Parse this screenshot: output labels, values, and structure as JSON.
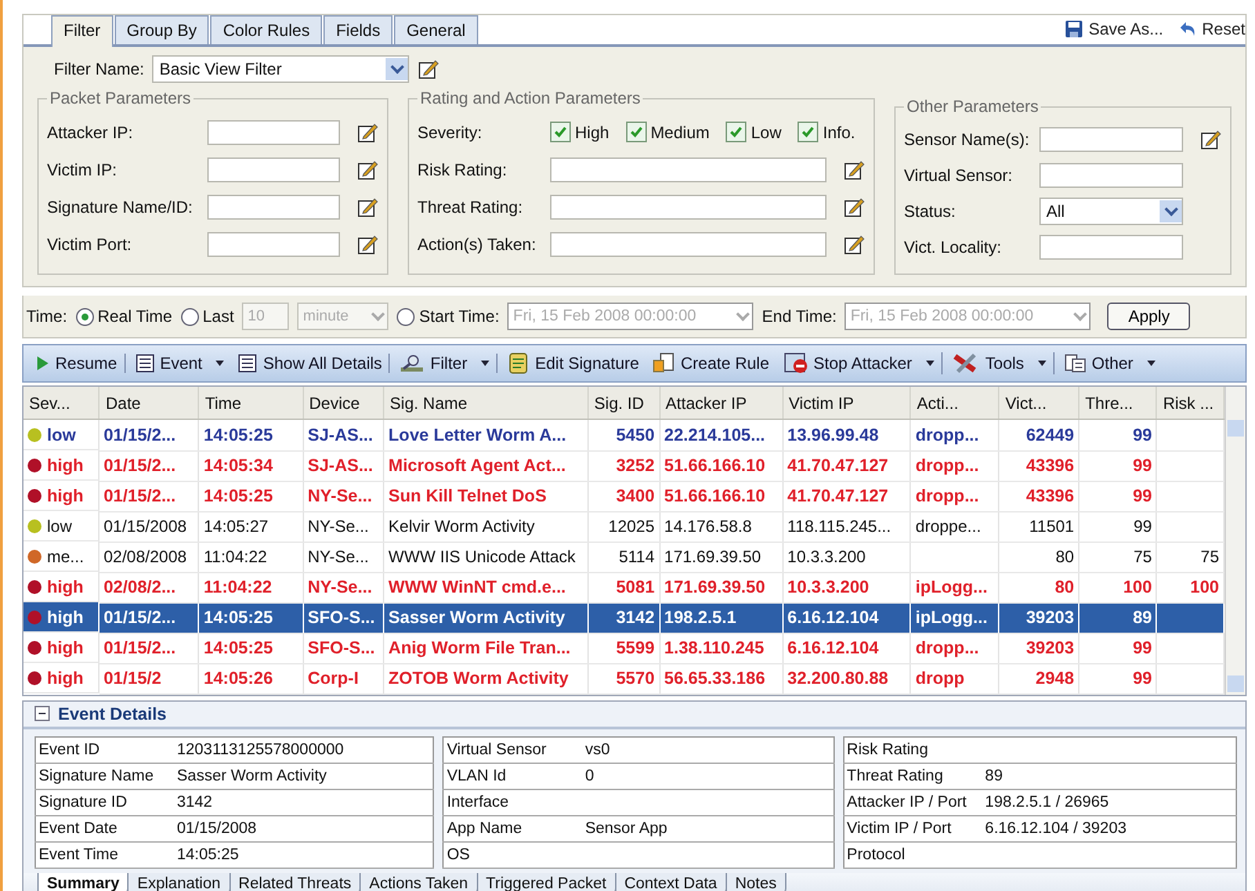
{
  "filter_tabs": [
    {
      "label": "Filter",
      "selected": true
    },
    {
      "label": "Group By",
      "selected": false
    },
    {
      "label": "Color Rules",
      "selected": false
    },
    {
      "label": "Fields",
      "selected": false
    },
    {
      "label": "General",
      "selected": false
    }
  ],
  "actions": [
    "Save As...",
    "Reset"
  ],
  "filter_name": {
    "label": "Filter Name:",
    "value": "Basic View Filter"
  },
  "packet_parameters": {
    "title": "Packet Parameters",
    "fields": [
      "Attacker IP:",
      "Victim IP:",
      "Signature Name/ID:",
      "Victim Port:"
    ]
  },
  "rating_parameters": {
    "title": "Rating and Action Parameters",
    "severity_label": "Severity:",
    "severity": [
      {
        "label": "High",
        "checked": true
      },
      {
        "label": "Medium",
        "checked": true
      },
      {
        "label": "Low",
        "checked": true
      },
      {
        "label": "Info.",
        "checked": true
      }
    ],
    "fields": [
      "Risk Rating:",
      "Threat Rating:",
      "Action(s) Taken:"
    ]
  },
  "other_parameters": {
    "title": "Other Parameters",
    "fields": [
      {
        "label": "Sensor Name(s):",
        "kind": "edit"
      },
      {
        "label": "Virtual Sensor:",
        "kind": "text"
      },
      {
        "label": "Status:",
        "kind": "select",
        "value": "All"
      },
      {
        "label": "Vict. Locality:",
        "kind": "text"
      }
    ]
  },
  "time": {
    "label": "Time:",
    "real_time": {
      "label": "Real Time",
      "selected": true
    },
    "last": {
      "label": "Last",
      "selected": false,
      "count": "10",
      "unit": "minute"
    },
    "start": {
      "label": "Start Time:",
      "selected": false,
      "value": "Fri, 15 Feb 2008 00:00:00"
    },
    "end": {
      "label": "End Time:",
      "value": "Fri, 15 Feb 2008 00:00:00"
    },
    "apply": "Apply"
  },
  "toolbar": [
    {
      "label": "Resume",
      "kind": "play",
      "dropdown": false,
      "separator": true
    },
    {
      "label": "Event",
      "kind": "list",
      "dropdown": true,
      "separator": false
    },
    {
      "label": "Show All Details",
      "kind": "list",
      "dropdown": false,
      "separator": true
    },
    {
      "label": "Filter",
      "kind": "filter",
      "dropdown": true,
      "separator": true
    },
    {
      "label": "Edit Signature",
      "kind": "scroll",
      "dropdown": false,
      "separator": false
    },
    {
      "label": "Create Rule",
      "kind": "rule",
      "dropdown": false,
      "separator": false
    },
    {
      "label": "Stop Attacker",
      "kind": "stop",
      "dropdown": true,
      "separator": true
    },
    {
      "label": "Tools",
      "kind": "tools",
      "dropdown": true,
      "separator": true
    },
    {
      "label": "Other",
      "kind": "doc",
      "dropdown": true,
      "separator": false
    }
  ],
  "table": {
    "columns": [
      "Sev...",
      "Date",
      "Time",
      "Device",
      "Sig. Name",
      "Sig. ID",
      "Attacker IP",
      "Victim IP",
      "Acti...",
      "Vict...",
      "Thre...",
      "Risk ..."
    ],
    "rows": [
      {
        "kind": "low",
        "new": true,
        "selected": false,
        "cells": [
          "low",
          "01/15/2...",
          "14:05:25",
          "SJ-AS...",
          "Love Letter Worm A...",
          "5450",
          "22.214.105...",
          "13.96.99.48",
          "dropp...",
          "62449",
          "99",
          null
        ]
      },
      {
        "kind": "high",
        "new": true,
        "selected": false,
        "cells": [
          "high",
          "01/15/2...",
          "14:05:34",
          "SJ-AS...",
          "Microsoft Agent Act...",
          "3252",
          "51.66.166.10",
          "41.70.47.127",
          "dropp...",
          "43396",
          "99",
          null
        ]
      },
      {
        "kind": "high",
        "new": true,
        "selected": false,
        "cells": [
          "high",
          "01/15/2...",
          "14:05:25",
          "NY-Se...",
          "Sun Kill Telnet DoS",
          "3400",
          "51.66.166.10",
          "41.70.47.127",
          "dropp...",
          "43396",
          "99",
          null
        ]
      },
      {
        "kind": "low",
        "new": false,
        "selected": false,
        "cells": [
          "low",
          "01/15/2008",
          "14:05:27",
          "NY-Se...",
          "Kelvir Worm Activity",
          "12025",
          "14.176.58.8",
          "118.115.245...",
          "droppe...",
          "11501",
          "99",
          null
        ]
      },
      {
        "kind": "medium",
        "new": false,
        "selected": false,
        "cells": [
          "me...",
          "02/08/2008",
          "11:04:22",
          "NY-Se...",
          "WWW IIS Unicode Attack",
          "5114",
          "171.69.39.50",
          "10.3.3.200",
          null,
          "80",
          "75",
          "75"
        ]
      },
      {
        "kind": "high",
        "new": true,
        "selected": false,
        "cells": [
          "high",
          "02/08/2...",
          "11:04:22",
          "NY-Se...",
          "WWW WinNT cmd.e...",
          "5081",
          "171.69.39.50",
          "10.3.3.200",
          "ipLogg...",
          "80",
          "100",
          "100"
        ]
      },
      {
        "kind": "high",
        "new": true,
        "selected": true,
        "cells": [
          "high",
          "01/15/2...",
          "14:05:25",
          "SFO-S...",
          "Sasser Worm Activity",
          "3142",
          "198.2.5.1",
          "6.16.12.104",
          "ipLogg...",
          "39203",
          "89",
          null
        ]
      },
      {
        "kind": "high",
        "new": true,
        "selected": false,
        "cells": [
          "high",
          "01/15/2...",
          "14:05:25",
          "SFO-S...",
          "Anig Worm File Tran...",
          "5599",
          "1.38.110.245",
          "6.16.12.104",
          "dropp...",
          "39203",
          "99",
          null
        ]
      },
      {
        "kind": "high",
        "new": true,
        "selected": false,
        "cells": [
          "high",
          "01/15/2",
          "14:05:26",
          "Corp-I",
          "ZOTOB Worm Activity",
          "5570",
          "56.65.33.186",
          "32.200.80.88",
          "dropp",
          "2948",
          "99",
          null
        ]
      }
    ]
  },
  "details": {
    "title": "Event Details",
    "expanded": true,
    "groups": [
      [
        {
          "label": "Event ID",
          "value": "1203113125578000000"
        },
        {
          "label": "Signature Name",
          "value": "Sasser Worm Activity"
        },
        {
          "label": "Signature ID",
          "value": "3142"
        },
        {
          "label": "Event Date",
          "value": "01/15/2008"
        },
        {
          "label": "Event Time",
          "value": "14:05:25"
        }
      ],
      [
        {
          "label": "Virtual Sensor",
          "value": "vs0"
        },
        {
          "label": "VLAN Id",
          "value": "0"
        },
        {
          "label": "Interface"
        },
        {
          "label": "App Name",
          "value": "Sensor App"
        },
        {
          "label": "OS"
        }
      ],
      [
        {
          "label": "Risk Rating"
        },
        {
          "label": "Threat Rating",
          "value": "89"
        },
        {
          "label": "Attacker IP / Port",
          "value": "198.2.5.1 / 26965"
        },
        {
          "label": "Victim IP / Port",
          "value": "6.16.12.104 / 39203"
        },
        {
          "label": "Protocol"
        }
      ]
    ],
    "tabs": [
      {
        "label": "Summary",
        "selected": true
      },
      {
        "label": "Explanation",
        "selected": false
      },
      {
        "label": "Related Threats",
        "selected": false
      },
      {
        "label": "Actions Taken",
        "selected": false
      },
      {
        "label": "Triggered Packet",
        "selected": false
      },
      {
        "label": "Context Data",
        "selected": false
      },
      {
        "label": "Notes",
        "selected": false
      }
    ]
  }
}
